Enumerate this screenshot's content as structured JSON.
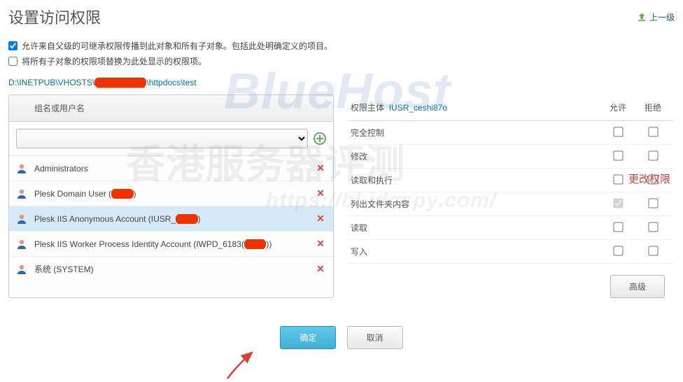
{
  "header": {
    "title": "设置访问权限",
    "up_link": "上一级"
  },
  "options": {
    "inherit_label": "允许来自父级的可继承权限传播到此对象和所有子对象。包括此处明确定义的项目。",
    "inherit_checked": true,
    "replace_label": "将所有子对象的权限项替换为此处显示的权限项。",
    "replace_checked": false
  },
  "path": {
    "prefix": "D:\\INETPUB\\VHOSTS\\",
    "hidden": "████████",
    "suffix": "\\httpdocs\\test"
  },
  "left": {
    "header": "组名或用户名",
    "select_placeholder": "",
    "users": [
      {
        "name": "Administrators",
        "redact": ""
      },
      {
        "name_pre": "Plesk Domain User (",
        "redact": "███",
        "name_post": ")"
      },
      {
        "name_pre": "Plesk IIS Anonymous Account (IUSR_",
        "redact": "███",
        "name_post": ")",
        "selected": true
      },
      {
        "name_pre": "Plesk IIS Worker Process Identity Account (IWPD_6183(",
        "redact": "███",
        "name_post": "))"
      },
      {
        "name": "系统 (SYSTEM)"
      }
    ]
  },
  "right": {
    "subject_label": "权限主体",
    "subject_value": "IUSR_ceshi87o",
    "allow_header": "允许",
    "deny_header": "拒绝",
    "perms": [
      {
        "label": "完全控制",
        "allow": false,
        "deny": false
      },
      {
        "label": "修改",
        "allow": false,
        "deny": false
      },
      {
        "label": "读取和执行",
        "allow": false,
        "deny": false
      },
      {
        "label": "列出文件夹内容",
        "allow": true,
        "deny": false,
        "allow_disabled": true
      },
      {
        "label": "读取",
        "allow": false,
        "deny": false
      },
      {
        "label": "写入",
        "allow": false,
        "deny": false
      }
    ],
    "change_note": "更改权限",
    "advanced": "高级"
  },
  "footer": {
    "ok": "确定",
    "cancel": "取消"
  },
  "watermarks": {
    "w1": "BlueHost",
    "w2": "香港服务器评测",
    "w3": "https://bl.idcspy.com/"
  }
}
